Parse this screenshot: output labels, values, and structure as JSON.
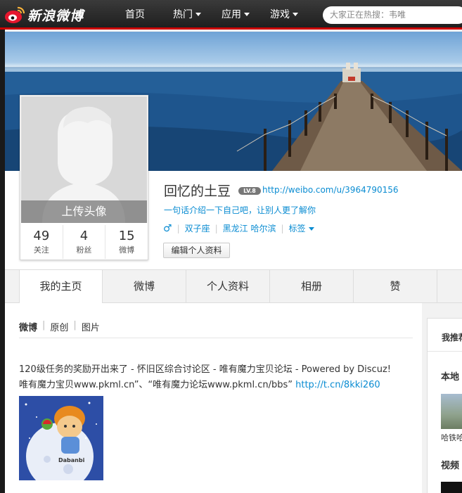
{
  "brand": {
    "logo_text": "新浪微博"
  },
  "nav": {
    "items": [
      {
        "label": "首页",
        "dropdown": false
      },
      {
        "label": "热门",
        "dropdown": true
      },
      {
        "label": "应用",
        "dropdown": true
      },
      {
        "label": "游戏",
        "dropdown": true
      }
    ],
    "search_placeholder": "大家正在热搜：韦唯"
  },
  "profile": {
    "avatar_upload_label": "上传头像",
    "stats": [
      {
        "value": "49",
        "label": "关注"
      },
      {
        "value": "4",
        "label": "粉丝"
      },
      {
        "value": "15",
        "label": "微博"
      }
    ],
    "username": "回忆的土豆",
    "level_badge": "LV.8",
    "url": "http://weibo.com/u/3964790156",
    "intro": "一句话介绍一下自己吧，让别人更了解你",
    "gender_icon": "male-icon",
    "zodiac": "双子座",
    "location": "黑龙江 哈尔滨",
    "tags_label": "标签",
    "edit_button": "编辑个人资料"
  },
  "tabs": [
    {
      "label": "我的主页",
      "active": true
    },
    {
      "label": "微博",
      "active": false
    },
    {
      "label": "个人资料",
      "active": false
    },
    {
      "label": "相册",
      "active": false
    },
    {
      "label": "赞",
      "active": false
    }
  ],
  "feed": {
    "subtabs": [
      {
        "label": "微博",
        "active": true
      },
      {
        "label": "原创",
        "active": false
      },
      {
        "label": "图片",
        "active": false
      }
    ],
    "post": {
      "line1": "120级任务的奖励开出来了 - 怀旧区综合讨论区 - 唯有魔力宝贝论坛 - Powered by Discuz!",
      "line2": "唯有魔力宝贝www.pkml.cn”、“唯有魔力论坛www.pkml.cn/bbs” ",
      "link": "http://t.cn/8kki260"
    }
  },
  "sidebar": {
    "recommend_title": "我推荐",
    "local_title": "本地",
    "local_caption": "哈铁哈",
    "video_title": "视频"
  },
  "colors": {
    "accent_red": "#cc0000",
    "link_blue": "#0a8cd2",
    "nav_dark": "#2a2a2a"
  }
}
